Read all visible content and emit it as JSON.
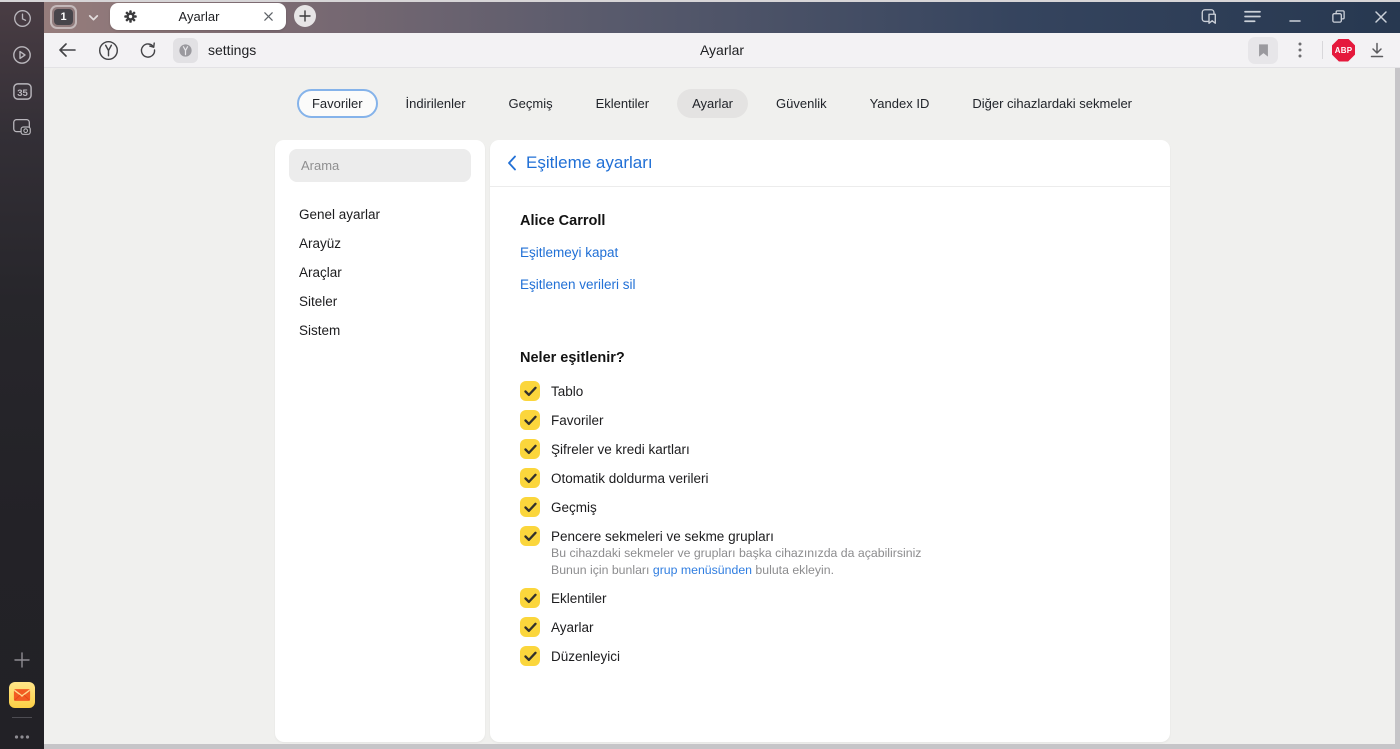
{
  "colors": {
    "accent_blue": "#2170d6",
    "checkbox_yellow": "#fbd63c",
    "abp_red": "#e5193c",
    "favorites_outline": "#85b3ea"
  },
  "left_rail": {
    "tab_counter": "35"
  },
  "tab_bar": {
    "group_badge": "1",
    "tab_title": "Ayarlar"
  },
  "toolbar": {
    "url_text": "settings",
    "page_title": "Ayarlar",
    "abp_label": "ABP"
  },
  "nav_tabs": [
    {
      "label": "Favoriler",
      "state": "focused"
    },
    {
      "label": "İndirilenler",
      "state": "normal"
    },
    {
      "label": "Geçmiş",
      "state": "normal"
    },
    {
      "label": "Eklentiler",
      "state": "normal"
    },
    {
      "label": "Ayarlar",
      "state": "active"
    },
    {
      "label": "Güvenlik",
      "state": "normal"
    },
    {
      "label": "Yandex ID",
      "state": "normal"
    },
    {
      "label": "Diğer cihazlardaki sekmeler",
      "state": "normal"
    }
  ],
  "settings_sidebar": {
    "search_placeholder": "Arama",
    "items": [
      {
        "label": "Genel ayarlar"
      },
      {
        "label": "Arayüz"
      },
      {
        "label": "Araçlar"
      },
      {
        "label": "Siteler"
      },
      {
        "label": "Sistem"
      }
    ]
  },
  "sync_panel": {
    "title": "Eşitleme ayarları",
    "account_name": "Alice Carroll",
    "link_disable": "Eşitlemeyi kapat",
    "link_delete": "Eşitlenen verileri sil",
    "section_title": "Neler eşitlenir?",
    "items": [
      {
        "label": "Tablo",
        "checked": true
      },
      {
        "label": "Favoriler",
        "checked": true
      },
      {
        "label": "Şifreler ve kredi kartları",
        "checked": true
      },
      {
        "label": "Otomatik doldurma verileri",
        "checked": true
      },
      {
        "label": "Geçmiş",
        "checked": true
      },
      {
        "label": "Pencere sekmeleri ve sekme grupları",
        "checked": true,
        "description_line1": "Bu cihazdaki sekmeler ve grupları başka cihazınızda da açabilirsiniz",
        "description_line2_prefix": "Bunun için bunları ",
        "description_line2_link": "grup menüsünden",
        "description_line2_suffix": " buluta ekleyin."
      },
      {
        "label": "Eklentiler",
        "checked": true
      },
      {
        "label": "Ayarlar",
        "checked": true
      },
      {
        "label": "Düzenleyici",
        "checked": true
      }
    ]
  }
}
